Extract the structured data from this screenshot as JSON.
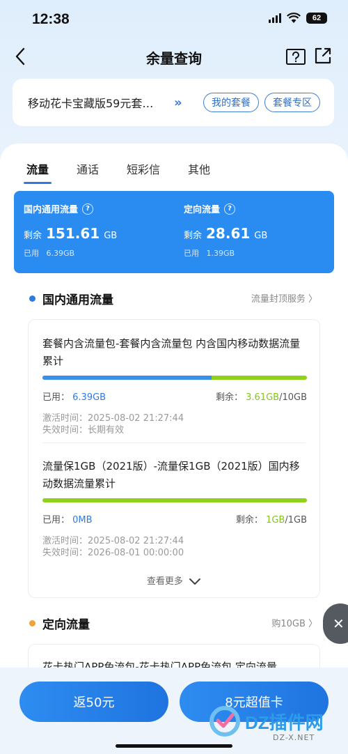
{
  "status": {
    "time": "12:38",
    "battery": "62"
  },
  "nav": {
    "title": "余量查询"
  },
  "plan": {
    "name": "移动花卡宝藏版59元套…",
    "chevron": "»",
    "my_plan": "我的套餐",
    "plan_zone": "套餐专区"
  },
  "tabs": [
    "流量",
    "通话",
    "短彩信",
    "其他"
  ],
  "summary": {
    "domestic": {
      "title": "国内通用流量",
      "remain_label": "剩余",
      "remain_value": "151.61",
      "unit": "GB",
      "used_label": "已用",
      "used_value": "6.39GB"
    },
    "targeted": {
      "title": "定向流量",
      "remain_label": "剩余",
      "remain_value": "28.61",
      "unit": "GB",
      "used_label": "已用",
      "used_value": "1.39GB"
    }
  },
  "domestic_section": {
    "title": "国内通用流量",
    "link": "流量封顶服务 〉",
    "packages": [
      {
        "name": "套餐内含流量包-套餐内含流量包 内含国内移动数据流量累计",
        "used_label": "已用：",
        "used": "6.39GB",
        "remain_label": "剩余：",
        "remain": "3.61GB",
        "total": "/10GB",
        "used_fraction": 0.639,
        "activated_label": "激活时间：",
        "activated": "2025-08-02 21:27:44",
        "expire_label": "失效时间：",
        "expire": "长期有效"
      },
      {
        "name": "流量保1GB（2021版）-流量保1GB（2021版）国内移动数据流量累计",
        "used_label": "已用：",
        "used": "0MB",
        "remain_label": "剩余：",
        "remain": "1GB",
        "total": "/1GB",
        "used_fraction": 0,
        "activated_label": "激活时间：",
        "activated": "2025-08-02 21:27:44",
        "expire_label": "失效时间：",
        "expire": "2026-08-01 00:00:00"
      }
    ],
    "more": "查看更多"
  },
  "targeted_section": {
    "title": "定向流量",
    "link": "购10GB 〉",
    "first_package": "花卡热门APP免流包-花卡热门APP免流包 定向流量"
  },
  "buttons": {
    "rebate": "返50元",
    "value_card": "8元超值卡"
  },
  "watermark": {
    "brand": "DZ插件网",
    "domain": "DZ-X.NET"
  },
  "colors": {
    "accent": "#2a8bf0",
    "used_bar": "#3a8fe8",
    "remain_bar": "#8fd11c",
    "domestic_dot": "#2f7be0",
    "targeted_dot": "#f0a23a"
  }
}
